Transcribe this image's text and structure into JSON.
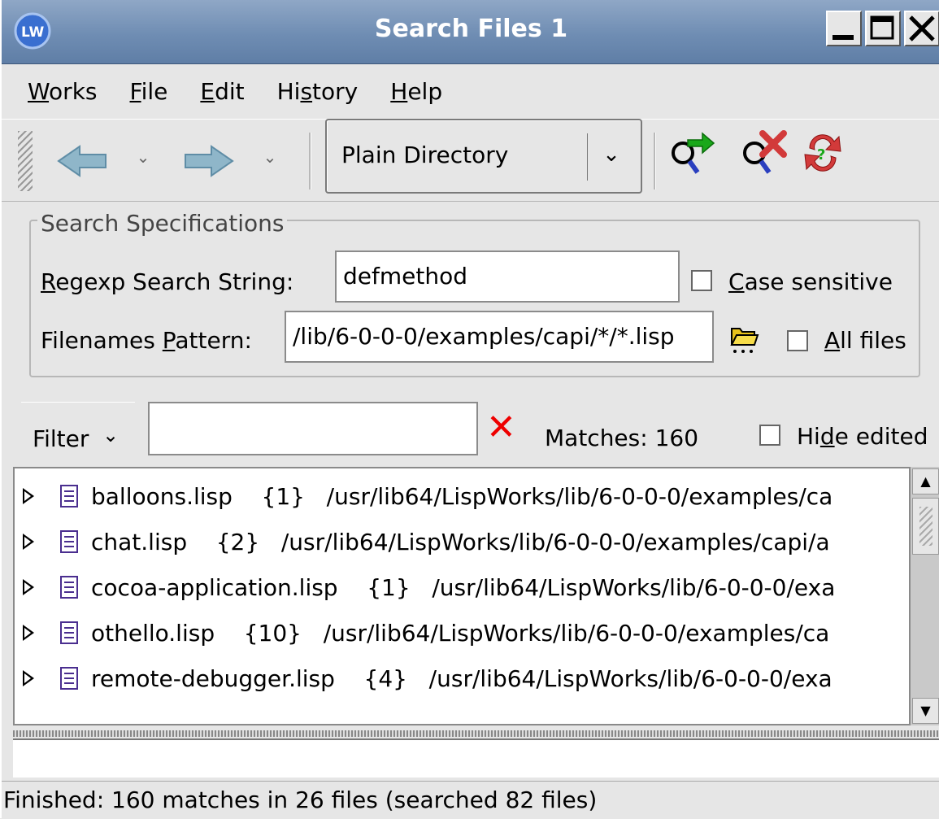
{
  "window": {
    "title": "Search Files 1",
    "app_icon": "lispworks-icon",
    "controls": [
      "minimize-icon",
      "maximize-icon",
      "close-icon"
    ]
  },
  "menu": {
    "items": [
      {
        "label_pre": "",
        "label_ul": "W",
        "label_post": "orks"
      },
      {
        "label_pre": "",
        "label_ul": "F",
        "label_post": "ile"
      },
      {
        "label_pre": "",
        "label_ul": "E",
        "label_post": "dit"
      },
      {
        "label_pre": "Hi",
        "label_ul": "s",
        "label_post": "tory"
      },
      {
        "label_pre": "",
        "label_ul": "H",
        "label_post": "elp"
      }
    ]
  },
  "toolbar": {
    "back_icon": "back-arrow-icon",
    "forward_icon": "forward-arrow-icon",
    "search_type": "Plain Directory",
    "search_icon": "search-go-icon",
    "stop_icon": "search-stop-icon",
    "refresh_icon": "refresh-icon"
  },
  "search_spec": {
    "group_title": "Search Specifications",
    "regexp_label_ul": "R",
    "regexp_label_rest": "egexp Search String:",
    "regexp_value": "defmethod",
    "case_label_ul": "C",
    "case_label_rest": "ase sensitive",
    "case_checked": false,
    "pattern_label_pre": "Filenames ",
    "pattern_label_ul": "P",
    "pattern_label_rest": "attern:",
    "pattern_value": "/lib/6-0-0-0/examples/capi/*/*.lisp",
    "browse_icon": "folder-browse-icon",
    "allfiles_label_ul": "A",
    "allfiles_label_rest": "ll files",
    "allfiles_checked": false
  },
  "filter": {
    "label": "Filter",
    "value": "",
    "clear_icon": "clear-filter-icon",
    "matches_text": "Matches: 160",
    "hide_label_pre": "Hi",
    "hide_label_ul": "d",
    "hide_label_rest": "e edited",
    "hide_checked": false
  },
  "results": [
    {
      "file": "balloons.lisp",
      "count": "{1}",
      "path": "/usr/lib64/LispWorks/lib/6-0-0-0/examples/ca"
    },
    {
      "file": "chat.lisp",
      "count": "{2}",
      "path": "/usr/lib64/LispWorks/lib/6-0-0-0/examples/capi/a"
    },
    {
      "file": "cocoa-application.lisp",
      "count": "{1}",
      "path": "/usr/lib64/LispWorks/lib/6-0-0-0/exa"
    },
    {
      "file": "othello.lisp",
      "count": "{10}",
      "path": "/usr/lib64/LispWorks/lib/6-0-0-0/examples/ca"
    },
    {
      "file": "remote-debugger.lisp",
      "count": "{4}",
      "path": "/usr/lib64/LispWorks/lib/6-0-0-0/exa"
    }
  ],
  "status": {
    "text": "Finished:  160 matches in 26 files (searched 82 files)"
  }
}
